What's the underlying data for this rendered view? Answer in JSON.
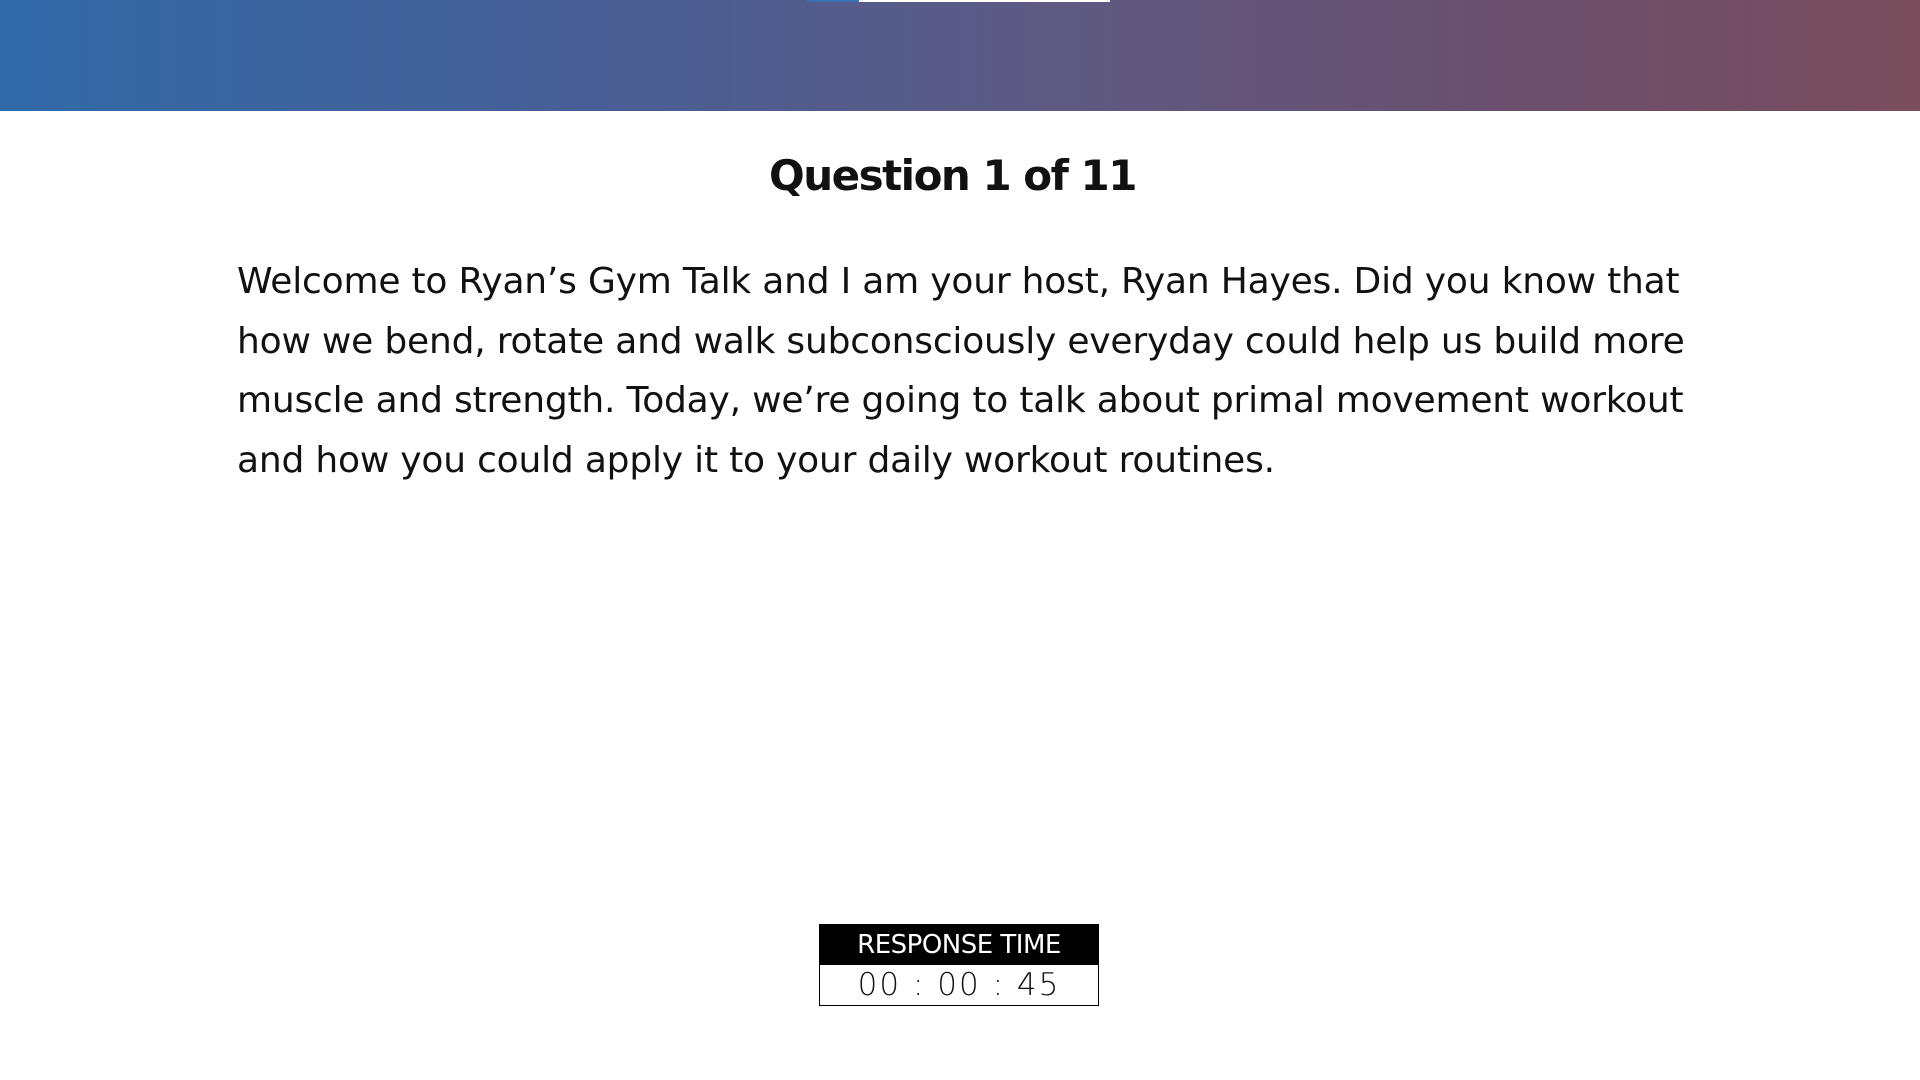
{
  "header": {
    "progress_fraction": 0.17
  },
  "question": {
    "title": "Question 1 of 11",
    "body": "Welcome to Ryan’s Gym Talk and I am your host, Ryan Hayes. Did you know that how we bend, rotate and walk subconsciously everyday could help us build more muscle and strength. Today, we’re going to talk about primal movement workout and how you could apply it to your daily workout routines."
  },
  "timer": {
    "label": "RESPONSE TIME",
    "value": "00 : 00 : 45"
  },
  "colors": {
    "header_gradient_start": "#316aa8",
    "header_gradient_end": "#7a4e5c",
    "progress_fill": "#3a6fb0",
    "timer_label_bg": "#000000",
    "timer_label_text": "#ffffff"
  }
}
